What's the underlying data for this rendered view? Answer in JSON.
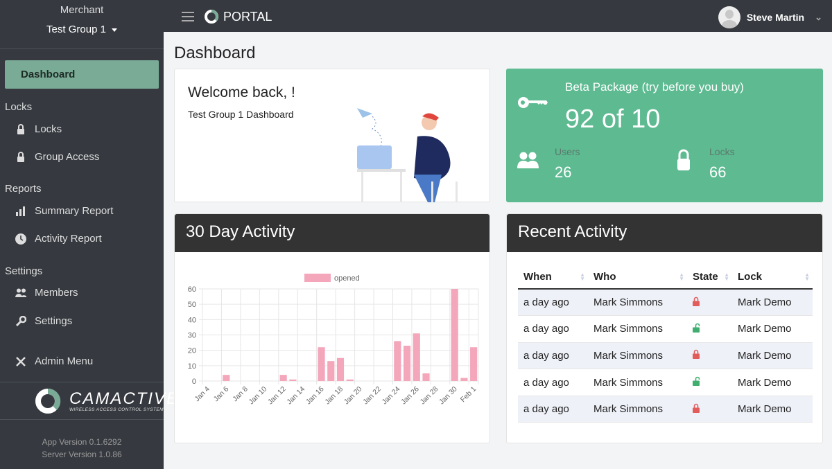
{
  "sidebar": {
    "merchant_label": "Merchant",
    "group": "Test Group 1",
    "active": "Dashboard",
    "sections": [
      {
        "title": "Locks",
        "items": [
          {
            "label": "Locks",
            "icon": "lock-icon"
          },
          {
            "label": "Group Access",
            "icon": "lock-icon"
          }
        ]
      },
      {
        "title": "Reports",
        "items": [
          {
            "label": "Summary Report",
            "icon": "bar-chart-icon"
          },
          {
            "label": "Activity Report",
            "icon": "clock-icon"
          }
        ]
      },
      {
        "title": "Settings",
        "items": [
          {
            "label": "Members",
            "icon": "users-icon"
          },
          {
            "label": "Settings",
            "icon": "wrench-icon"
          }
        ]
      }
    ],
    "admin": "Admin Menu",
    "brand": "CAMACTIVE",
    "brand_tagline": "WIRELESS ACCESS CONTROL SYSTEM",
    "app_version": "App Version 0.1.6292",
    "server_version": "Server Version 1.0.86"
  },
  "topbar": {
    "portal": "PORTAL",
    "user": "Steve Martin"
  },
  "page_title": "Dashboard",
  "welcome": {
    "title": "Welcome back, !",
    "subtitle": "Test Group 1 Dashboard"
  },
  "package": {
    "title": "Beta Package (try before you buy)",
    "usage": "92 of 10",
    "users_label": "Users",
    "users": "26",
    "locks_label": "Locks",
    "locks": "66",
    "color": "#5dba91"
  },
  "activity": {
    "title": "30 Day Activity"
  },
  "recent": {
    "title": "Recent Activity",
    "columns": [
      "When",
      "Who",
      "State",
      "Lock"
    ],
    "rows": [
      {
        "when": "a day ago",
        "who": "Mark Simmons",
        "state": "locked",
        "lock": "Mark Demo"
      },
      {
        "when": "a day ago",
        "who": "Mark Simmons",
        "state": "unlocked",
        "lock": "Mark Demo"
      },
      {
        "when": "a day ago",
        "who": "Mark Simmons",
        "state": "locked",
        "lock": "Mark Demo"
      },
      {
        "when": "a day ago",
        "who": "Mark Simmons",
        "state": "unlocked",
        "lock": "Mark Demo"
      },
      {
        "when": "a day ago",
        "who": "Mark Simmons",
        "state": "locked",
        "lock": "Mark Demo"
      }
    ],
    "colors": {
      "locked": "#e25c5c",
      "unlocked": "#3fae6f"
    }
  },
  "chart_data": {
    "type": "bar",
    "legend": [
      "opened"
    ],
    "legend_position": "top",
    "color": "#f4a6bb",
    "grid": true,
    "ylim": [
      0,
      60
    ],
    "yticks": [
      0,
      10,
      20,
      30,
      40,
      50,
      60
    ],
    "categories": [
      "Jan 4",
      "Jan 5",
      "Jan 6",
      "Jan 7",
      "Jan 8",
      "Jan 9",
      "Jan 10",
      "Jan 11",
      "Jan 12",
      "Jan 13",
      "Jan 14",
      "Jan 15",
      "Jan 16",
      "Jan 17",
      "Jan 18",
      "Jan 19",
      "Jan 20",
      "Jan 21",
      "Jan 22",
      "Jan 23",
      "Jan 24",
      "Jan 25",
      "Jan 26",
      "Jan 27",
      "Jan 28",
      "Jan 29",
      "Jan 30",
      "Jan 31",
      "Feb 1"
    ],
    "series": [
      {
        "name": "opened",
        "values": [
          0,
          0,
          4,
          0,
          0,
          0,
          0,
          0,
          4,
          1,
          0,
          0,
          22,
          13,
          15,
          1,
          0,
          0,
          0,
          0,
          26,
          23,
          31,
          5,
          0,
          0,
          60,
          2,
          22
        ]
      }
    ]
  }
}
